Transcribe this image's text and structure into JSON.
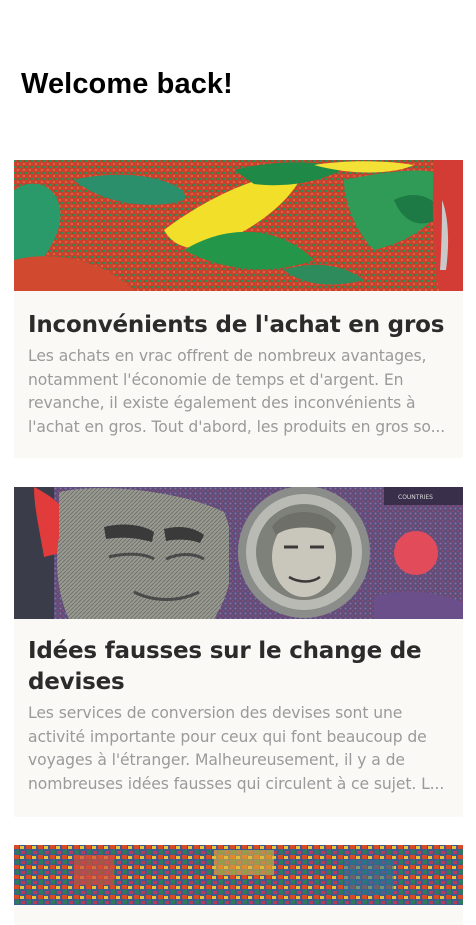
{
  "header": {
    "title": "Welcome back!"
  },
  "articles": [
    {
      "image": "abstract-colorful-shapes-image",
      "title": "Inconvénients de l'achat en gros",
      "excerpt": "Les achats en vrac offrent de nombreux avantages, notamment l'économie de temps et d'argent. En revanche, il existe également des inconvénients à l'achat en gros. Tout d'abord, les produits en gros so..."
    },
    {
      "image": "currency-portrait-illustration-image",
      "title": "Idées fausses sur le change de devises",
      "excerpt": "Les services de conversion des devises sont une activité importante pour ceux qui font beaucoup de voyages à l'étranger. Malheureusement, il y a de nombreuses idées fausses qui circulent à ce sujet. L..."
    },
    {
      "image": "colorful-mosaic-image"
    }
  ],
  "colors": {
    "background": "#ffffff",
    "card_background": "#faf9f6",
    "title": "#2b2b2b",
    "excerpt": "#9a9a9a"
  }
}
